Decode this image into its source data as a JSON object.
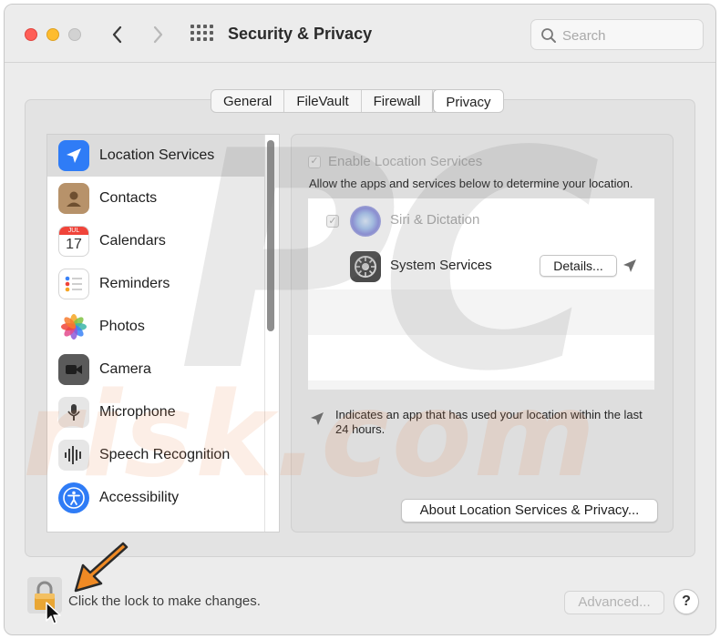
{
  "window": {
    "title": "Security & Privacy"
  },
  "search": {
    "placeholder": "Search"
  },
  "tabs": [
    {
      "label": "General",
      "active": false
    },
    {
      "label": "FileVault",
      "active": false
    },
    {
      "label": "Firewall",
      "active": false
    },
    {
      "label": "Privacy",
      "active": true
    }
  ],
  "sidebar": {
    "items": [
      {
        "label": "Location Services",
        "icon": "location-arrow-icon",
        "selected": true
      },
      {
        "label": "Contacts",
        "icon": "contacts-icon",
        "selected": false
      },
      {
        "label": "Calendars",
        "icon": "calendar-icon",
        "selected": false
      },
      {
        "label": "Reminders",
        "icon": "reminders-icon",
        "selected": false
      },
      {
        "label": "Photos",
        "icon": "photos-icon",
        "selected": false
      },
      {
        "label": "Camera",
        "icon": "camera-icon",
        "selected": false
      },
      {
        "label": "Microphone",
        "icon": "microphone-icon",
        "selected": false
      },
      {
        "label": "Speech Recognition",
        "icon": "speech-waveform-icon",
        "selected": false
      },
      {
        "label": "Accessibility",
        "icon": "accessibility-icon",
        "selected": false
      }
    ],
    "calendar_icon": {
      "month": "JUL",
      "day": "17"
    }
  },
  "location": {
    "enable_label": "Enable Location Services",
    "enable_checkmark": "✓",
    "allow_text": "Allow the apps and services below to determine your location.",
    "apps": [
      {
        "name": "Siri & Dictation",
        "checkmark": "✓",
        "enabled": false
      },
      {
        "name": "System Services",
        "details_label": "Details...",
        "enabled": true
      }
    ],
    "legend_text": "Indicates an app that has used your location within the last 24 hours.",
    "about_button": "About Location Services & Privacy..."
  },
  "footer": {
    "lock_text": "Click the lock to make changes.",
    "advanced_button": "Advanced...",
    "help_button": "?"
  },
  "watermark": {
    "line1": "PC",
    "line2": "risk.com"
  },
  "colors": {
    "accent_blue": "#2f7cf6",
    "orange_arrow": "#f08a24",
    "window_bg": "#ececec"
  }
}
